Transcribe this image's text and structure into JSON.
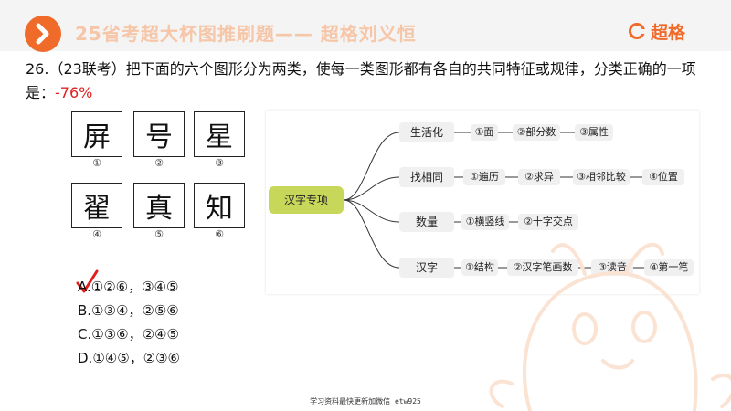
{
  "header": {
    "title": "25省考超大杯图推刷题—— 超格刘义恒",
    "brand": "超格",
    "accent_color": "#f06a2a",
    "arrow_icon": "chevron-right-icon"
  },
  "question": {
    "text": "26.（23联考）把下面的六个图形分为两类，使每一类图形都有各自的共同特征或规律，分类正确的一项是：",
    "accuracy": "-76%"
  },
  "characters": [
    {
      "char": "屏",
      "num": "①"
    },
    {
      "char": "号",
      "num": "②"
    },
    {
      "char": "星",
      "num": "③"
    },
    {
      "char": "翟",
      "num": "④"
    },
    {
      "char": "真",
      "num": "⑤"
    },
    {
      "char": "知",
      "num": "⑥"
    }
  ],
  "mindmap": {
    "root": "汉字专项",
    "branches": [
      {
        "label": "生活化",
        "items": [
          "①面",
          "②部分数",
          "③属性"
        ]
      },
      {
        "label": "找相同",
        "items": [
          "①遍历",
          "②求异",
          "③相邻比较",
          "④位置"
        ]
      },
      {
        "label": "数量",
        "items": [
          "①横竖线",
          "②十字交点"
        ]
      },
      {
        "label": "汉字",
        "items": [
          "①结构",
          "②汉字笔画数",
          "③读音",
          "④第一笔"
        ]
      }
    ]
  },
  "options": [
    {
      "label": "A.①②⑥，③④⑤",
      "marked": true
    },
    {
      "label": "B.①③④，②⑤⑥",
      "marked": false
    },
    {
      "label": "C.①③⑥，②④⑤",
      "marked": false
    },
    {
      "label": "D.①④⑤，②③⑥",
      "marked": false
    }
  ],
  "footer": "学习资料最快更新加微信 etw925"
}
